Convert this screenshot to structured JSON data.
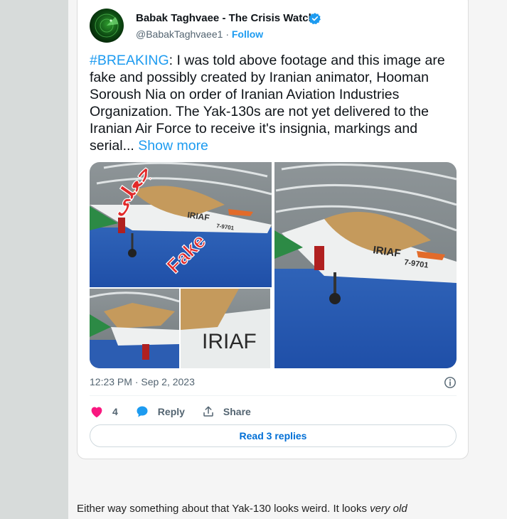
{
  "tweet": {
    "author_name": "Babak Taghvaee - The Crisis Watch",
    "handle": "@BabakTaghvaee1",
    "separator": "·",
    "follow_label": "Follow",
    "hashtag": "#BREAKING",
    "text": ": I was told above footage and this image are fake and possibly created by Iranian animator, Hooman Soroush Nia on order of Iranian Aviation Industries Organization. The Yak-130s are not yet delivered to the Iranian Air Force to receive it's insignia, markings and serial...",
    "show_more_label": "Show more",
    "timestamp": "12:23 PM · Sep 2, 2023",
    "like_count": "4",
    "reply_label": "Reply",
    "share_label": "Share",
    "read_replies_label": "Read 3 replies",
    "media": {
      "label_arabic": "جعلی",
      "label_fake": "Fake",
      "marking": "IRIAF",
      "serial": "7-9701"
    }
  },
  "comment": {
    "text_start": "Either way something about that Yak-130 looks weird. It looks ",
    "text_emphasis": "very old"
  },
  "colors": {
    "accent": "#1d9bf0",
    "like": "#f91880",
    "muted": "#536471"
  }
}
